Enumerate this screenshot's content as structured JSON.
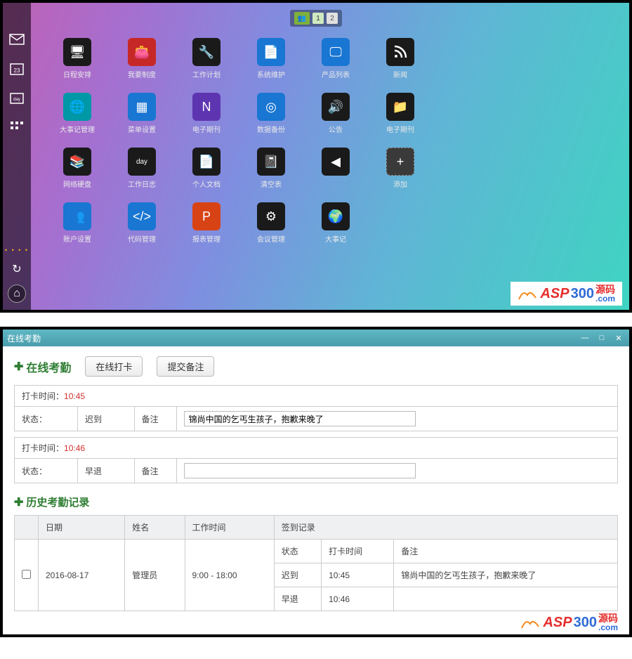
{
  "pager": {
    "p1": "1",
    "p2": "2"
  },
  "apps": {
    "r1": [
      {
        "label": "日程安排",
        "color": "t-dark",
        "icon": "display-icon"
      },
      {
        "label": "我要制度",
        "color": "t-red",
        "icon": "wallet-icon"
      },
      {
        "label": "工作计划",
        "color": "t-dark",
        "icon": "wrench-icon"
      },
      {
        "label": "系统维护",
        "color": "t-blue",
        "icon": "file-icon"
      },
      {
        "label": "产品列表",
        "color": "t-blue",
        "icon": "monitor-icon"
      },
      {
        "label": "新闻",
        "color": "t-dark",
        "icon": "rss-icon"
      }
    ],
    "r2": [
      {
        "label": "大事记管理",
        "color": "t-cyan",
        "icon": "globe-icon"
      },
      {
        "label": "菜单设置",
        "color": "t-blue",
        "icon": "grid-icon"
      },
      {
        "label": "电子期刊",
        "color": "t-purple",
        "icon": "note-icon"
      },
      {
        "label": "数据备份",
        "color": "t-blue",
        "icon": "disc-icon"
      },
      {
        "label": "公告",
        "color": "t-dark",
        "icon": "sound-icon"
      },
      {
        "label": "电子期刊",
        "color": "t-dark",
        "icon": "folder-icon"
      }
    ],
    "r3": [
      {
        "label": "网络硬盘",
        "color": "t-dark",
        "icon": "layers-icon"
      },
      {
        "label": "工作日志",
        "color": "t-dark",
        "icon": "day-icon"
      },
      {
        "label": "个人文档",
        "color": "t-dark",
        "icon": "doc-icon"
      },
      {
        "label": "清空表",
        "color": "t-dark",
        "icon": "book-icon"
      },
      {
        "label": "",
        "color": "t-dark",
        "icon": "sound-off-icon"
      },
      {
        "label": "添加",
        "color": "t-gray",
        "icon": "plus-icon"
      }
    ],
    "r4": [
      {
        "label": "账户设置",
        "color": "t-blue",
        "icon": "users-icon"
      },
      {
        "label": "代码管理",
        "color": "t-blue",
        "icon": "code-icon"
      },
      {
        "label": "报表管理",
        "color": "t-orange",
        "icon": "ppt-icon"
      },
      {
        "label": "会议管理",
        "color": "t-dark",
        "icon": "sliders-icon"
      },
      {
        "label": "大事记",
        "color": "t-dark",
        "icon": "world-icon"
      }
    ]
  },
  "watermark": {
    "brand_left": "ASP",
    "brand_right": "300",
    "cn1": "源码",
    "cn2": ".com"
  },
  "window": {
    "title": "在线考勤",
    "section_title": "在线考勤",
    "btn_clock": "在线打卡",
    "btn_submit": "提交备注",
    "row1": {
      "time_label": "打卡时间：",
      "time": "10:45",
      "status_label": "状态：",
      "status": "迟到",
      "remark_label": "备注",
      "remark": "锦尚中国的乞丐生孩子，抱歉来晚了"
    },
    "row2": {
      "time_label": "打卡时间：",
      "time": "10:46",
      "status_label": "状态：",
      "status": "早退",
      "remark_label": "备注",
      "remark": ""
    },
    "history": {
      "title": "历史考勤记录",
      "headers": {
        "date": "日期",
        "name": "姓名",
        "work_time": "工作时间",
        "sign_record": "签到记录",
        "sub_status": "状态",
        "sub_time": "打卡时间",
        "sub_remark": "备注"
      },
      "rows": [
        {
          "date": "2016-08-17",
          "name": "管理员",
          "work_time": "9:00 - 18:00",
          "details": [
            {
              "status": "迟到",
              "time": "10:45",
              "remark": "锦尚中国的乞丐生孩子，抱歉来晚了"
            },
            {
              "status": "早退",
              "time": "10:46",
              "remark": ""
            }
          ]
        }
      ]
    }
  }
}
